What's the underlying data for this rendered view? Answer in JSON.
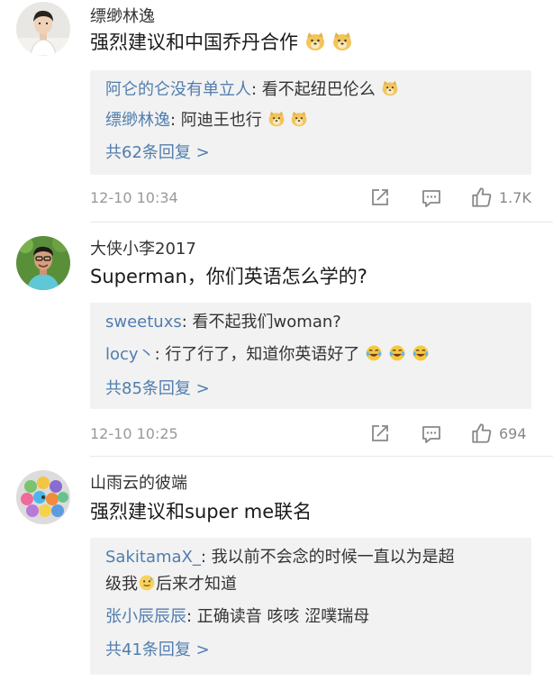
{
  "comments": [
    {
      "username": "缥缈林逸",
      "text": "强烈建议和中国乔丹合作",
      "emojis": [
        "doge-emoji",
        "doge-emoji"
      ],
      "replies": [
        {
          "name": "阿仑的仑没有单立人",
          "sep": ": ",
          "text": "看不起纽巴伦么",
          "emojis": [
            "doge-emoji"
          ]
        },
        {
          "name": "缥缈林逸",
          "sep": ": ",
          "text": "阿迪王也行",
          "emojis": [
            "doge-emoji",
            "doge-emoji"
          ]
        }
      ],
      "more": "共62条回复 >",
      "time": "12-10 10:34",
      "likes": "1.7K"
    },
    {
      "username": "大侠小李2017",
      "text": "Superman，你们英语怎么学的?",
      "replies": [
        {
          "name": "sweetuxs",
          "sep": ": ",
          "text": "看不起我们woman?"
        },
        {
          "name": "locy丶",
          "sep": ": ",
          "text": "行了行了，知道你英语好了",
          "emojis": [
            "laugh-cry-emoji",
            "laugh-cry-emoji",
            "laugh-cry-emoji"
          ]
        }
      ],
      "more": "共85条回复 >",
      "time": "12-10 10:25",
      "likes": "694"
    },
    {
      "username": "山雨云的彼端",
      "text": "强烈建议和super me联名",
      "replies": [
        {
          "name": "SakitamaX_",
          "sep": ": ",
          "text": "我以前不会念的时候一直以为是超",
          "text2": "级我",
          "text3": "后来才知道",
          "emojis": [
            "awkward-smile-emoji"
          ]
        },
        {
          "name": "张小辰辰辰",
          "sep": ": ",
          "text": "正确读音 咳咳 涩噗瑞母"
        }
      ],
      "more": "共41条回复 >"
    }
  ]
}
